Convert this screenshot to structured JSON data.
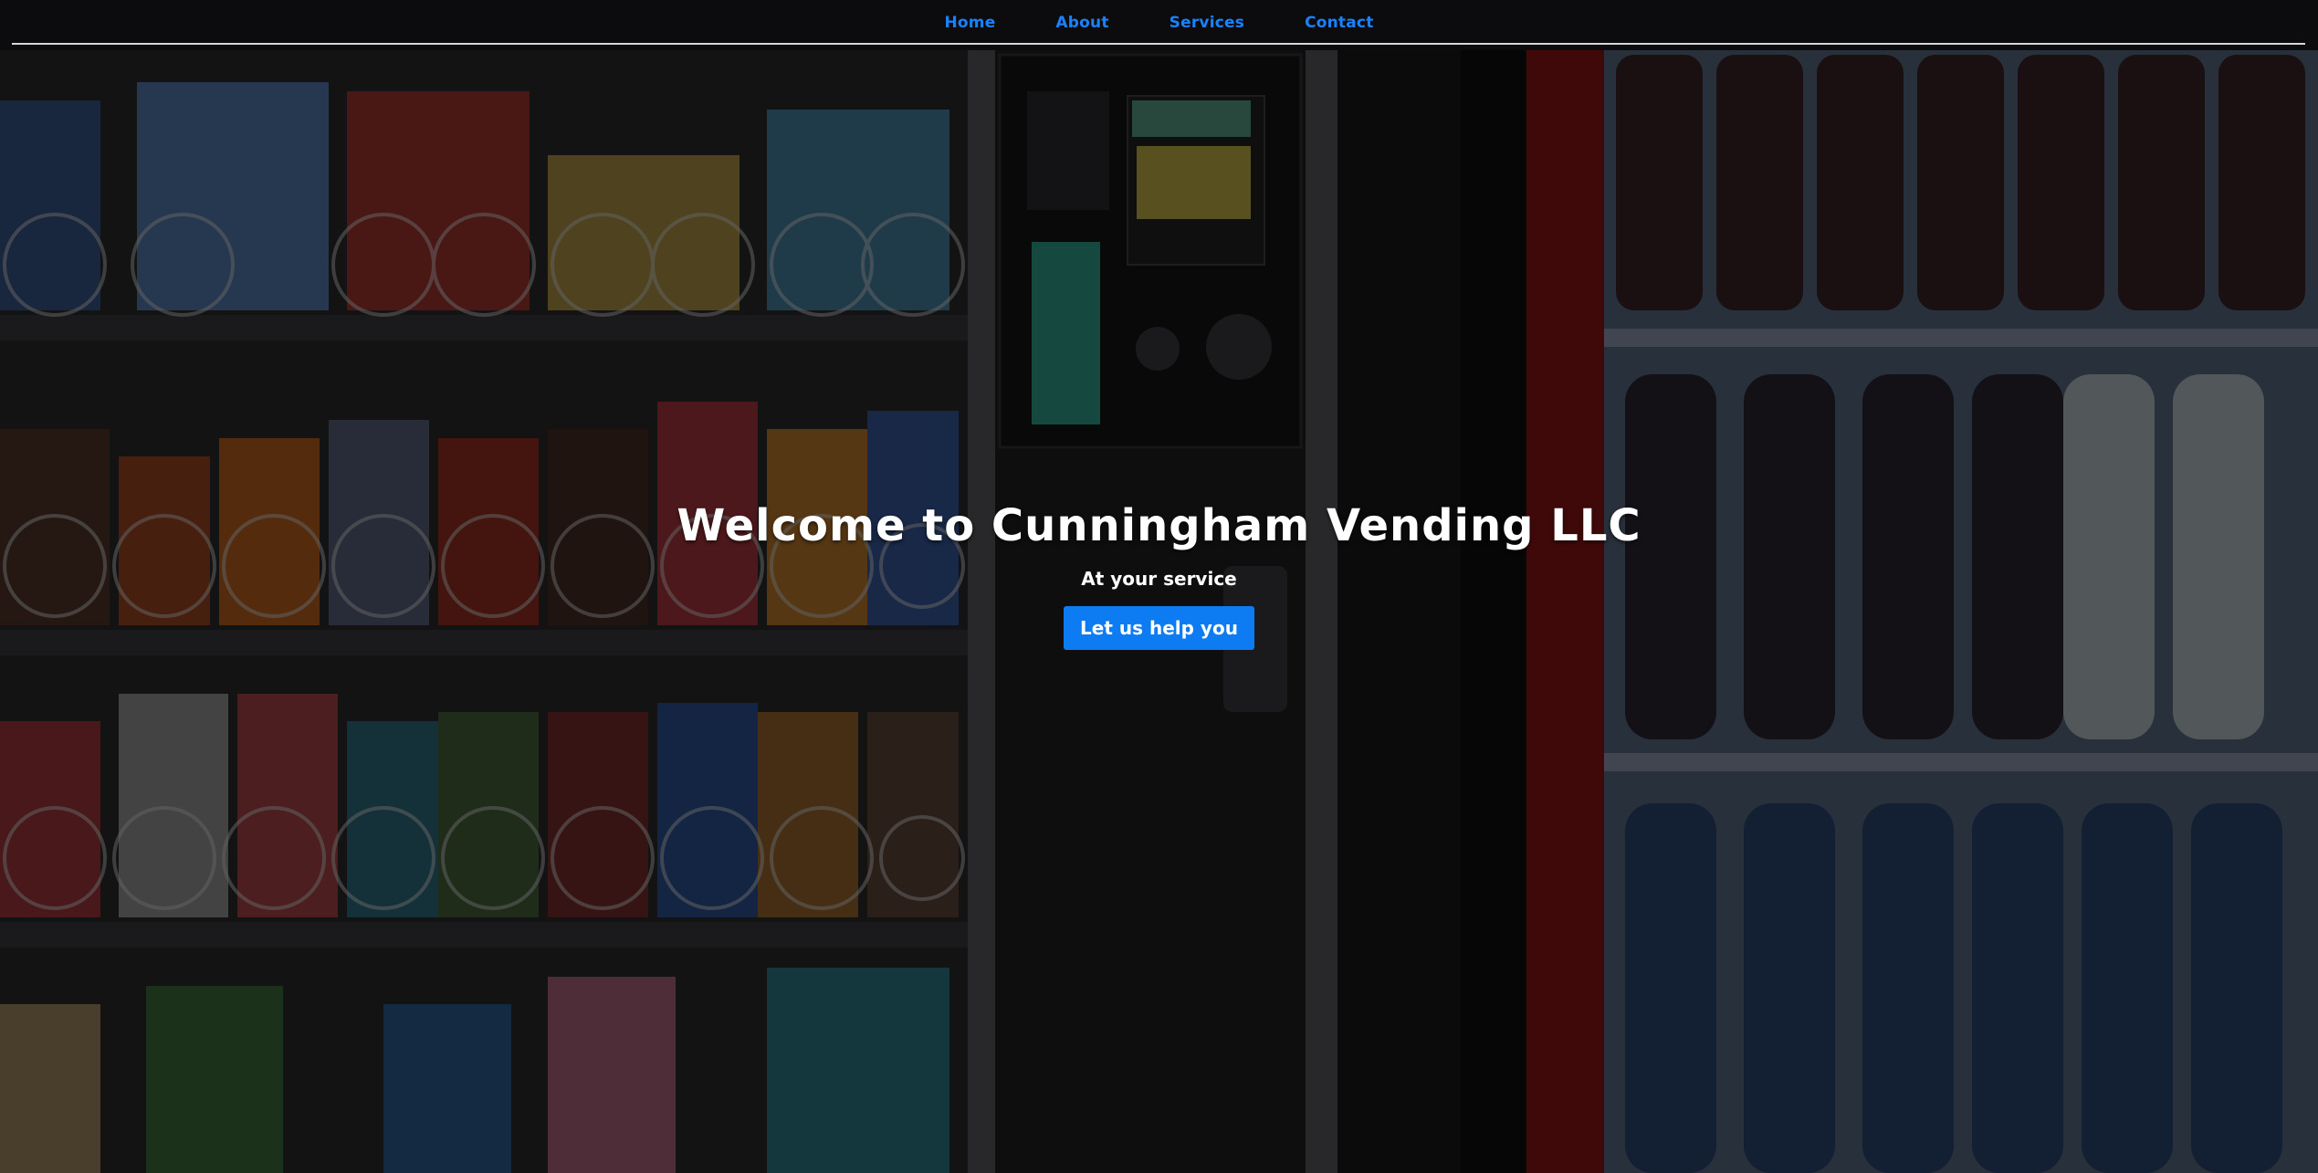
{
  "nav": {
    "items": [
      {
        "label": "Home"
      },
      {
        "label": "About"
      },
      {
        "label": "Services"
      },
      {
        "label": "Contact"
      }
    ]
  },
  "hero": {
    "title": "Welcome to Cunningham Vending LLC",
    "subtitle": "At your service",
    "cta_label": "Let us help you",
    "background": "vending-machine-photo"
  },
  "colors": {
    "nav_link": "#1a82ff",
    "cta_background": "#0d7bf2",
    "text": "#ffffff",
    "rule": "#d8d8d8"
  }
}
